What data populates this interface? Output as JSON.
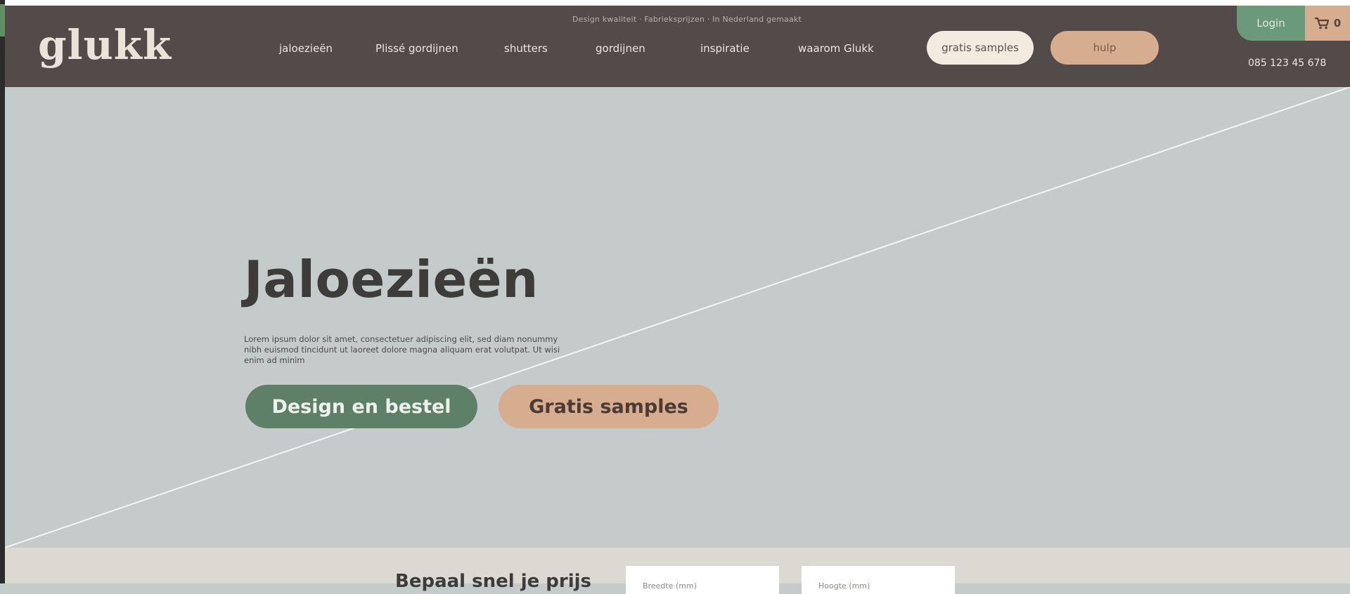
{
  "brand": {
    "logo": "glukk"
  },
  "header": {
    "tagline": "Design kwaliteit · Fabrieksprijzen · In Nederland gemaakt",
    "nav": [
      {
        "label": "jaloezieën"
      },
      {
        "label": "Plissé gordijnen"
      },
      {
        "label": "shutters"
      },
      {
        "label": "gordijnen"
      },
      {
        "label": "inspiratie"
      },
      {
        "label": "waarom Glukk"
      }
    ],
    "samples_label": "gratis samples",
    "help_label": "hulp",
    "login_label": "Login",
    "cart_icon": "cart-icon",
    "cart_count": "0",
    "phone": "085 123 45 678"
  },
  "hero": {
    "title": "Jaloezieën",
    "text": "Lorem ipsum dolor sit amet, consectetuer adipiscing elit, sed diam nonummy nibh euismod tincidunt ut laoreet dolore magna aliquam erat volutpat. Ut wisi enim ad minim",
    "primary_cta": "Design en bestel",
    "secondary_cta": "Gratis samples"
  },
  "price": {
    "title": "Bepaal snel je prijs",
    "width_placeholder": "Breedte (mm)",
    "height_placeholder": "Hoogte (mm)"
  },
  "colors": {
    "header_bg": "#524b4a",
    "hero_bg": "#c5cbcb",
    "green": "#5e8068",
    "sand": "#d6ad8e",
    "cream": "#f3ebdf"
  }
}
